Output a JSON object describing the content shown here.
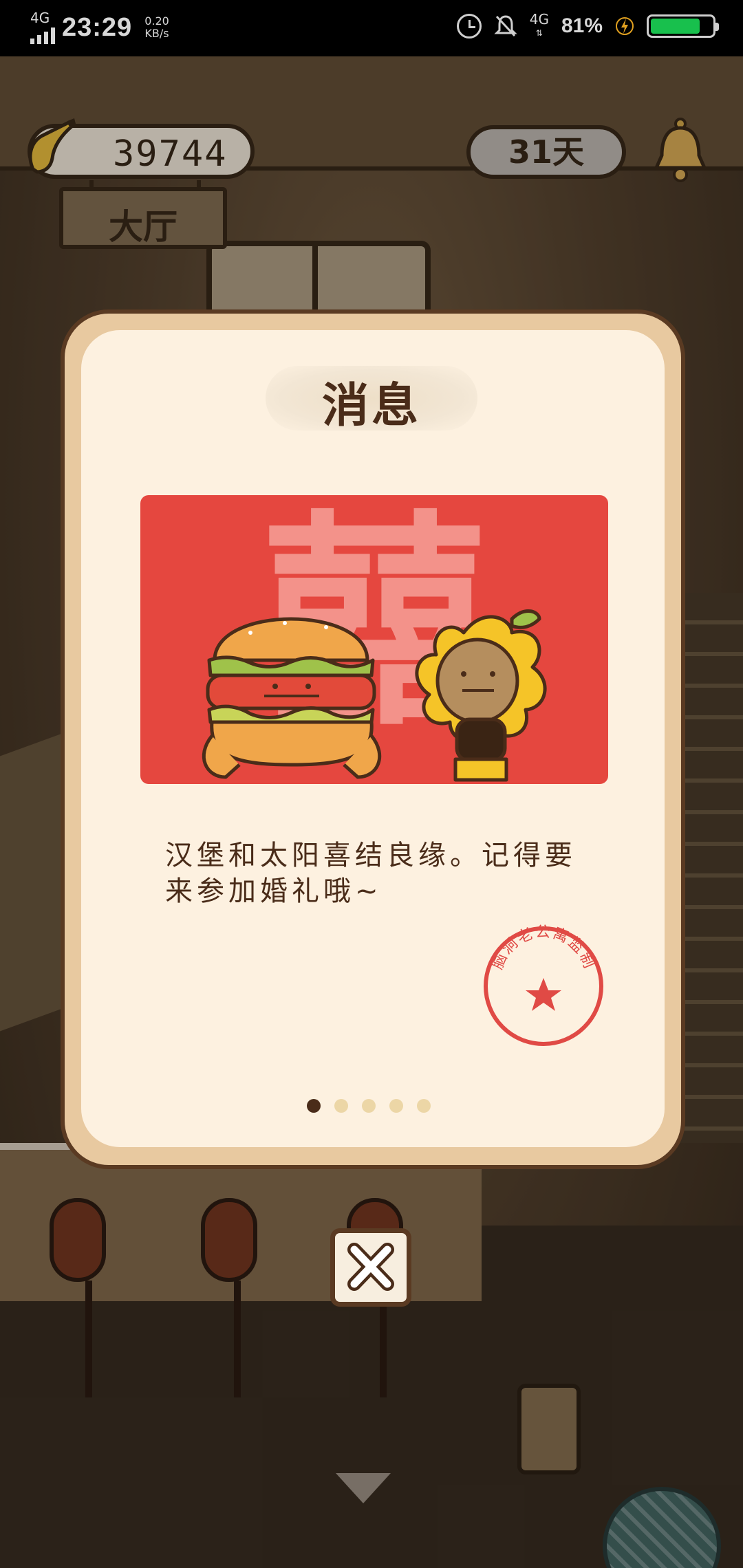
{
  "status_bar": {
    "network": "4G",
    "time": "23:29",
    "speed_value": "0.20",
    "speed_unit": "KB/s",
    "network2": "4G",
    "battery_percent": "81%",
    "battery_level": 0.81,
    "icons": [
      "signal-icon",
      "alarm-icon",
      "bell-muted-icon",
      "charging-icon",
      "battery-icon"
    ]
  },
  "hud": {
    "banana_count": "39744",
    "room_name": "大厅",
    "days": "31天"
  },
  "dialog": {
    "title": "消息",
    "card_character": "囍",
    "message": "汉堡和太阳喜结良缘。记得要来参加婚礼哦~",
    "stamp_text": "脑洞老公寓监制",
    "page_count": 5,
    "current_page": 1
  },
  "colors": {
    "card_red": "#e5473f",
    "dialog_bg": "#fdf1e0",
    "dialog_border": "#e8c9a0",
    "text_brown": "#4a2c19",
    "stamp_red": "#e04a45"
  }
}
